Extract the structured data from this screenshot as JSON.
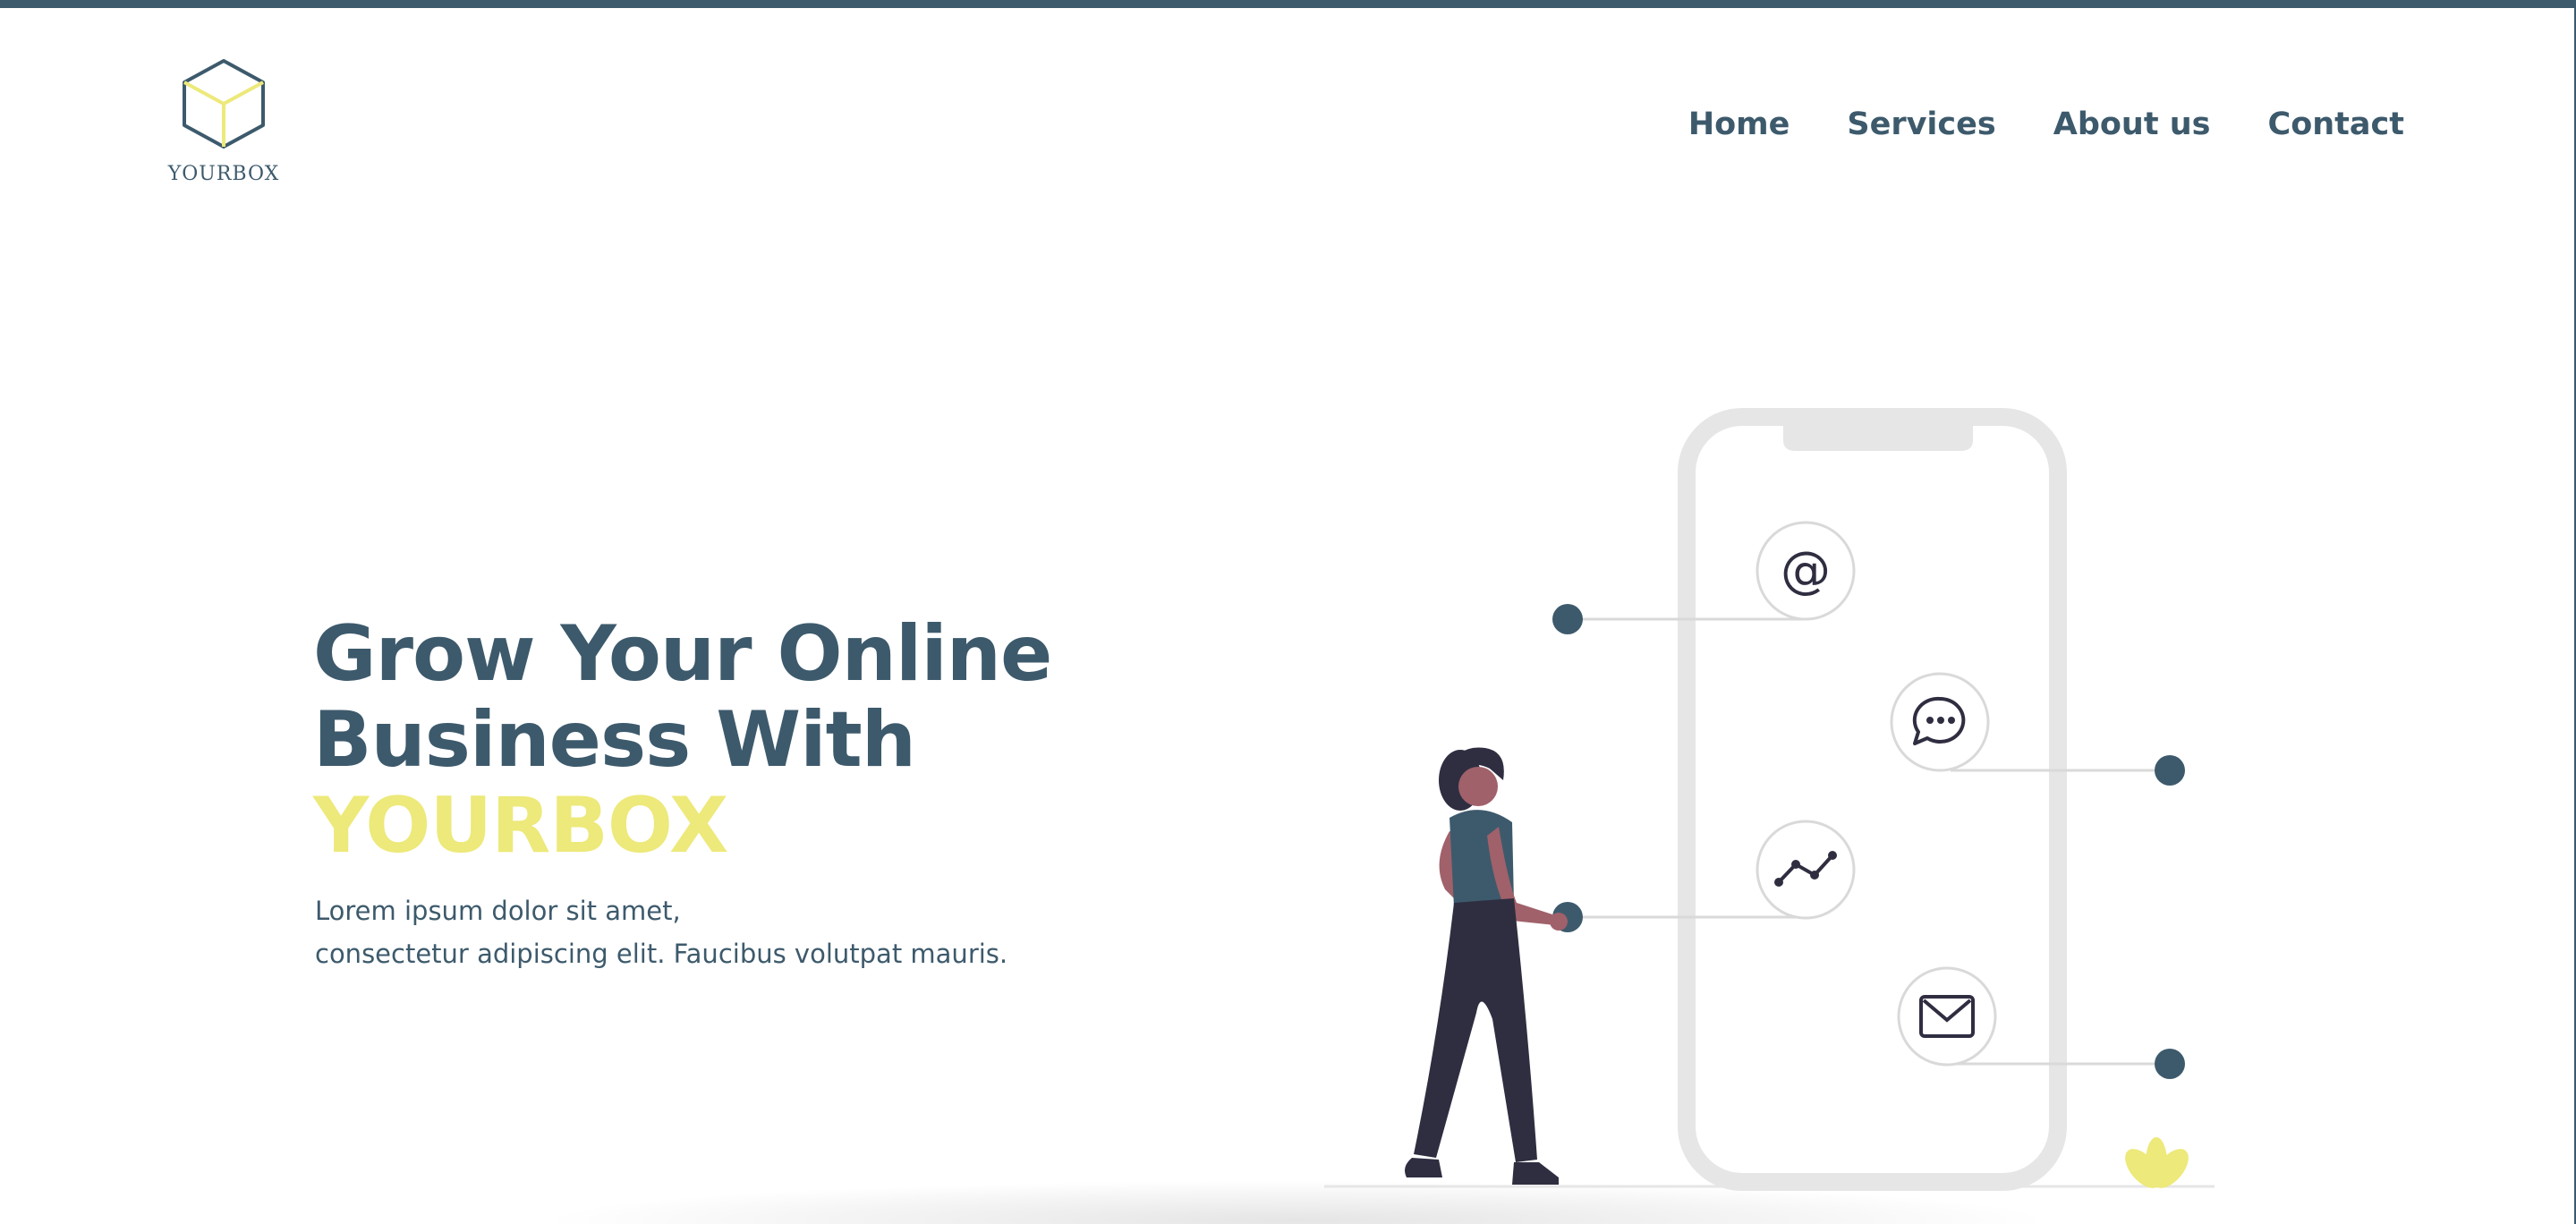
{
  "brand": {
    "name": "YOURBOX"
  },
  "nav": {
    "items": [
      {
        "label": "Home"
      },
      {
        "label": "Services"
      },
      {
        "label": "About us"
      },
      {
        "label": "Contact"
      }
    ]
  },
  "hero": {
    "title_line1": "Grow Your Online",
    "title_line2": "Business With",
    "title_brand": "YOURBOX",
    "subtitle_line1": "Lorem ipsum dolor sit amet,",
    "subtitle_line2": "consectetur adipiscing elit. Faucibus volutpat mauris."
  },
  "illustration": {
    "icons": [
      "at-icon",
      "chat-icon",
      "chart-icon",
      "mail-icon"
    ],
    "at_symbol": "@"
  },
  "colors": {
    "primary": "#3d5a6c",
    "accent": "#ede97a",
    "phone": "#e6e6e6",
    "figure_dark": "#2f2e41",
    "skin": "#a0616a"
  }
}
